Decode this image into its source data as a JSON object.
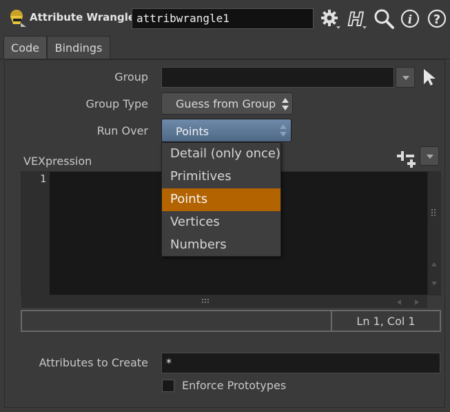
{
  "header": {
    "node_type": "Attribute Wrangle",
    "node_name": "attribwrangle1",
    "icons": [
      "wrangle-node-icon",
      "gear-icon",
      "houdini-help-icon",
      "search-icon",
      "info-icon",
      "help-icon"
    ]
  },
  "tabs": [
    {
      "label": "Code",
      "active": true
    },
    {
      "label": "Bindings",
      "active": false
    }
  ],
  "params": {
    "group_label": "Group",
    "group_value": "",
    "group_type_label": "Group Type",
    "group_type_value": "Guess from Group",
    "run_over_label": "Run Over",
    "run_over_value": "Points",
    "vexpression_label": "VEXpression",
    "attributes_label": "Attributes to Create",
    "attributes_value": "*",
    "enforce_label": "Enforce Prototypes",
    "enforce_checked": false
  },
  "run_over_options": [
    {
      "label": "Detail (only once)",
      "selected": false
    },
    {
      "label": "Primitives",
      "selected": false
    },
    {
      "label": "Points",
      "selected": true
    },
    {
      "label": "Vertices",
      "selected": false
    },
    {
      "label": "Numbers",
      "selected": false
    }
  ],
  "editor": {
    "line_numbers": [
      "1"
    ],
    "status": "Ln 1, Col 1"
  },
  "colors": {
    "selection": "#b36400",
    "run_over_button": "#5e7a9a"
  }
}
